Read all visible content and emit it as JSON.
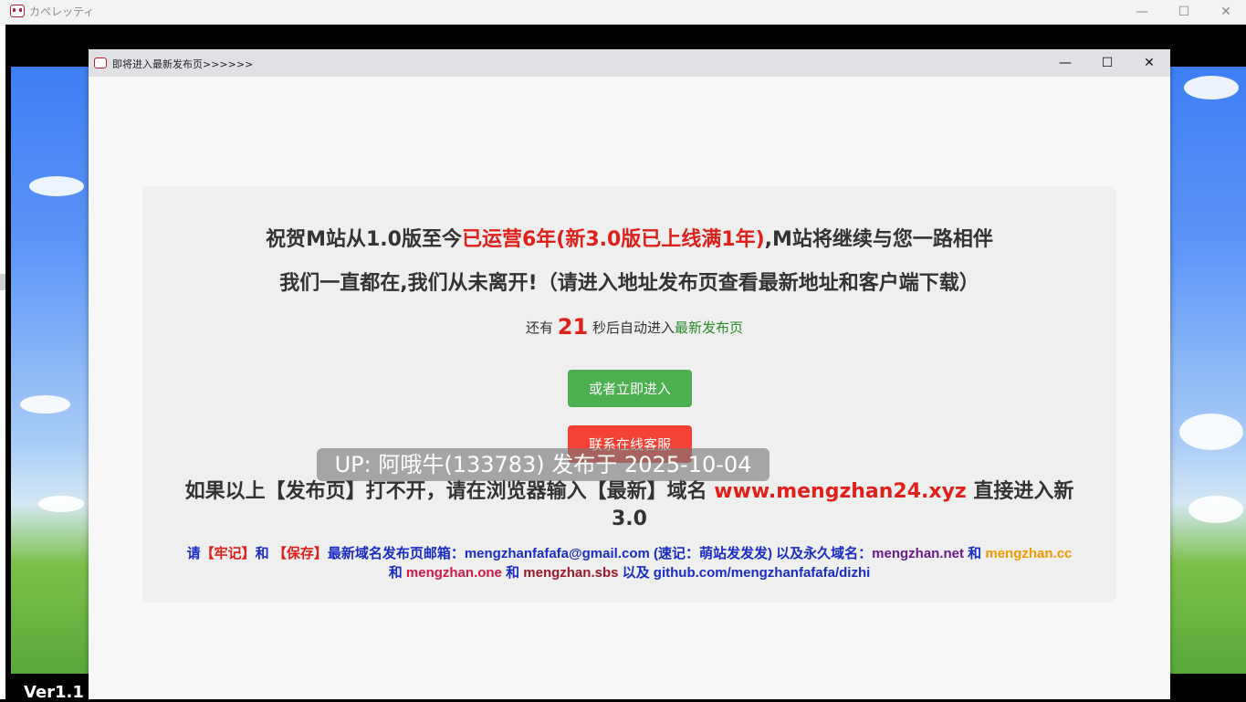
{
  "outer_window": {
    "title": "カペレッティ",
    "controls": {
      "minimize": "—",
      "maximize": "☐",
      "close": "✕"
    }
  },
  "game": {
    "version_label": "Ver1.1"
  },
  "inner_window": {
    "title": "即将进入最新发布页>>>>>>",
    "controls": {
      "minimize": "—",
      "maximize": "☐",
      "close": "✕"
    }
  },
  "content": {
    "line1_part1": "祝贺M站从1.0版至今",
    "line1_highlight": "已运营6年(新3.0版已上线满1年)",
    "line1_part2": ",M站将继续与您一路相伴",
    "line2": "我们一直都在,我们从未离开!（请进入地址发布页查看最新地址和客户端下载）",
    "countdown_prefix": "还有",
    "countdown_number": "21",
    "countdown_suffix": "秒后自动进入",
    "countdown_link": "最新发布页",
    "enter_button": "或者立即进入",
    "support_button": "联系在线客服",
    "line3_part1": "如果以上【发布页】打不开，请在浏览器输入【最新】域名",
    "line3_domain": "www.mengzhan24.xyz",
    "line3_part2": "直接进入新3.0",
    "line4": {
      "p1": "请",
      "p2": "【牢记】",
      "p3": "和",
      "p4": "【保存】",
      "p5": "最新域名发布页邮箱：mengzhanfafafa@gmail.com (速记：萌站发发发) 以及永久域名：",
      "p6": "mengzhan.net",
      "p7": "和",
      "p8": "mengzhan.cc",
      "p9": "和",
      "p10": "mengzhan.one",
      "p11": "和",
      "p12": "mengzhan.sbs",
      "p13": "以及 github.com/mengzhanfafafa/dizhi"
    },
    "watermark": "UP: 阿哦牛(133783) 发布于 2025-10-04"
  },
  "colors": {
    "green_button": "#4caf50",
    "red_button": "#f44336",
    "highlight_red": "#e0201a"
  }
}
